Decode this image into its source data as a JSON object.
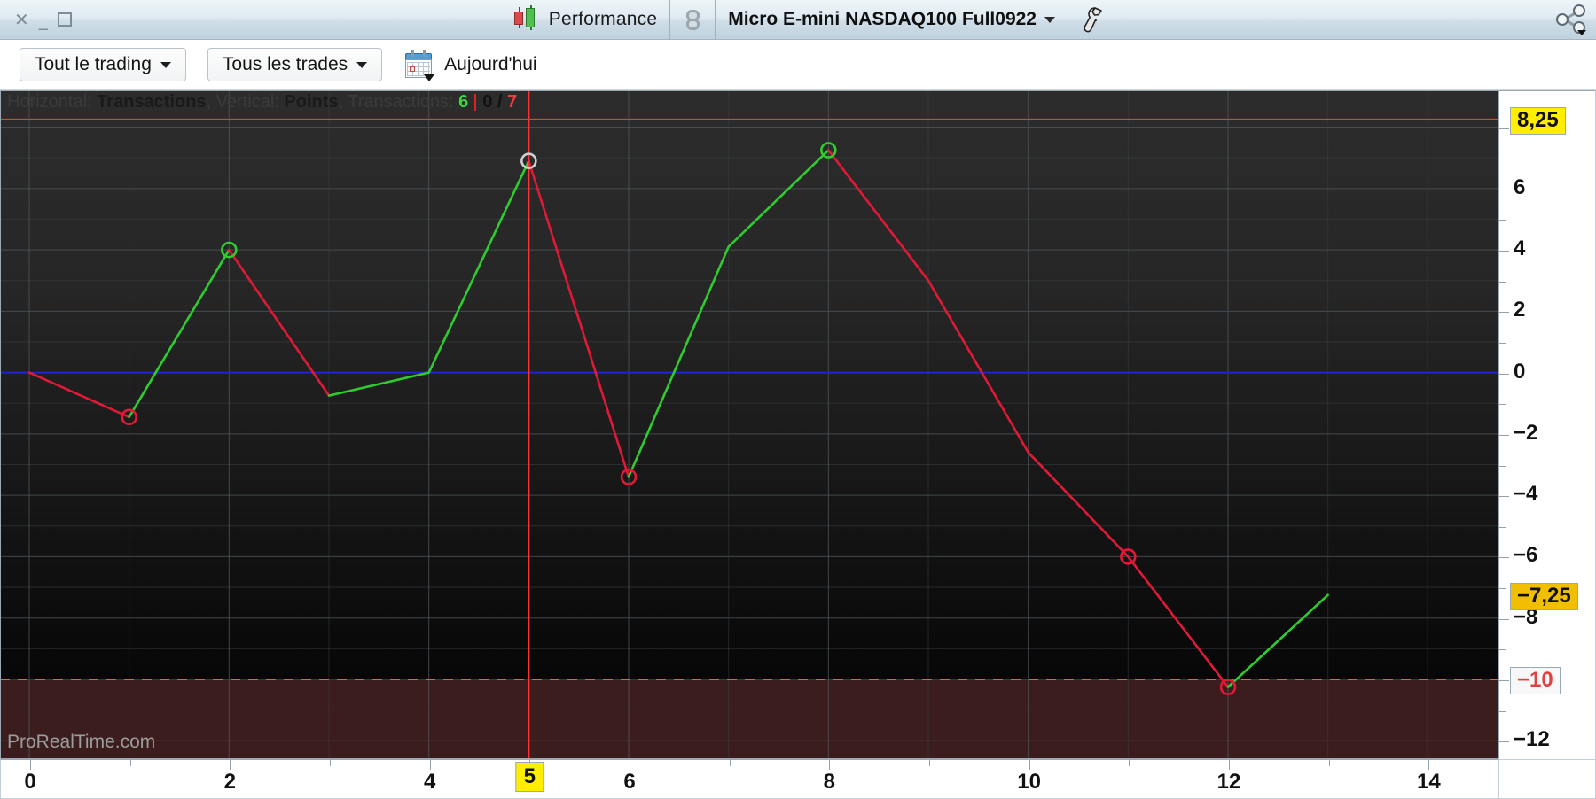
{
  "titlebar": {
    "close_label": "✕",
    "minimize_label": "_",
    "maximize_label": "",
    "performance_label": "Performance",
    "instrument_label": "Micro E-mini NASDAQ100 Full0922",
    "wrench_label": "⚒",
    "icons": {
      "candle": "candlestick-icon",
      "link": "link-icon",
      "share": "share-icon"
    }
  },
  "toolbar": {
    "trading_filter_label": "Tout le trading",
    "trades_filter_label": "Tous les trades",
    "today_label": "Aujourd'hui",
    "calendar_icon": "calendar-icon"
  },
  "chart_header": {
    "horizontal_prefix": "Horizontal:",
    "horizontal_value": "Transactions",
    "vertical_prefix": ", Vertical:",
    "vertical_value": "Points",
    "transactions_prefix": ", Transactions:",
    "wins": "6",
    "breakeven": "0",
    "losses": "7",
    "separator": "/"
  },
  "axis": {
    "y_labels": [
      "8",
      "6",
      "4",
      "2",
      "0",
      "−2",
      "−4",
      "−6",
      "−8",
      "−10",
      "−12"
    ],
    "x_labels": [
      "0",
      "2",
      "4",
      "6",
      "8",
      "10",
      "12",
      "14"
    ],
    "crosshair_y_badge": "8,25",
    "last_value_badge": "−7,25",
    "stop_level_badge": "−10",
    "crosshair_x_badge": "5"
  },
  "watermark": "ProRealTime.com",
  "colors": {
    "up": "#2fcc2f",
    "down": "#e01a36",
    "zero_line": "#2222dd",
    "crosshair": "#ff3333",
    "stop_line": "#e06060",
    "highlight_badge": "#ffee00",
    "value_badge": "#f2bf00",
    "loss_zone": "#3c1d1d"
  },
  "chart_data": {
    "type": "line",
    "title": "Performance - Micro E-mini NASDAQ100 Full0922",
    "xlabel": "Transactions",
    "ylabel": "Points",
    "xlim": [
      0,
      15
    ],
    "ylim": [
      -12.6,
      9.2
    ],
    "grid": true,
    "x": [
      0,
      1,
      2,
      3,
      4,
      5,
      6,
      7,
      8,
      9,
      10,
      11,
      12,
      13
    ],
    "y": [
      0,
      -1.45,
      4,
      -0.75,
      0,
      6.9,
      -3.4,
      4.1,
      7.25,
      3.0,
      -2.6,
      -6.0,
      -10.25,
      -7.25
    ],
    "segment_colors": [
      "down",
      "up",
      "down",
      "up",
      "up",
      "down",
      "up",
      "up",
      "down",
      "down",
      "down",
      "down",
      "up"
    ],
    "markers": [
      {
        "x": 1,
        "y": -1.45,
        "color": "down",
        "type": "circle"
      },
      {
        "x": 2,
        "y": 4,
        "color": "up",
        "type": "circle"
      },
      {
        "x": 5,
        "y": 6.9,
        "color": "crosshair-highlight",
        "type": "circle"
      },
      {
        "x": 6,
        "y": -3.4,
        "color": "down",
        "type": "circle"
      },
      {
        "x": 8,
        "y": 7.25,
        "color": "up",
        "type": "circle"
      },
      {
        "x": 11,
        "y": -6.0,
        "color": "down",
        "type": "circle"
      },
      {
        "x": 12,
        "y": -10.25,
        "color": "down",
        "type": "circle"
      }
    ],
    "reference_lines": [
      {
        "label": "8,25",
        "value": 8.25,
        "color": "#ff3333",
        "style": "solid"
      },
      {
        "label": "0",
        "value": 0,
        "color": "#2222dd",
        "style": "solid"
      },
      {
        "label": "−10",
        "value": -10,
        "color": "#e06060",
        "style": "dashed"
      }
    ],
    "crosshair": {
      "x": 5,
      "y_label": "8,25",
      "x_label": "5"
    },
    "legend": {
      "wins": 6,
      "breakeven": 0,
      "losses": 7
    }
  }
}
